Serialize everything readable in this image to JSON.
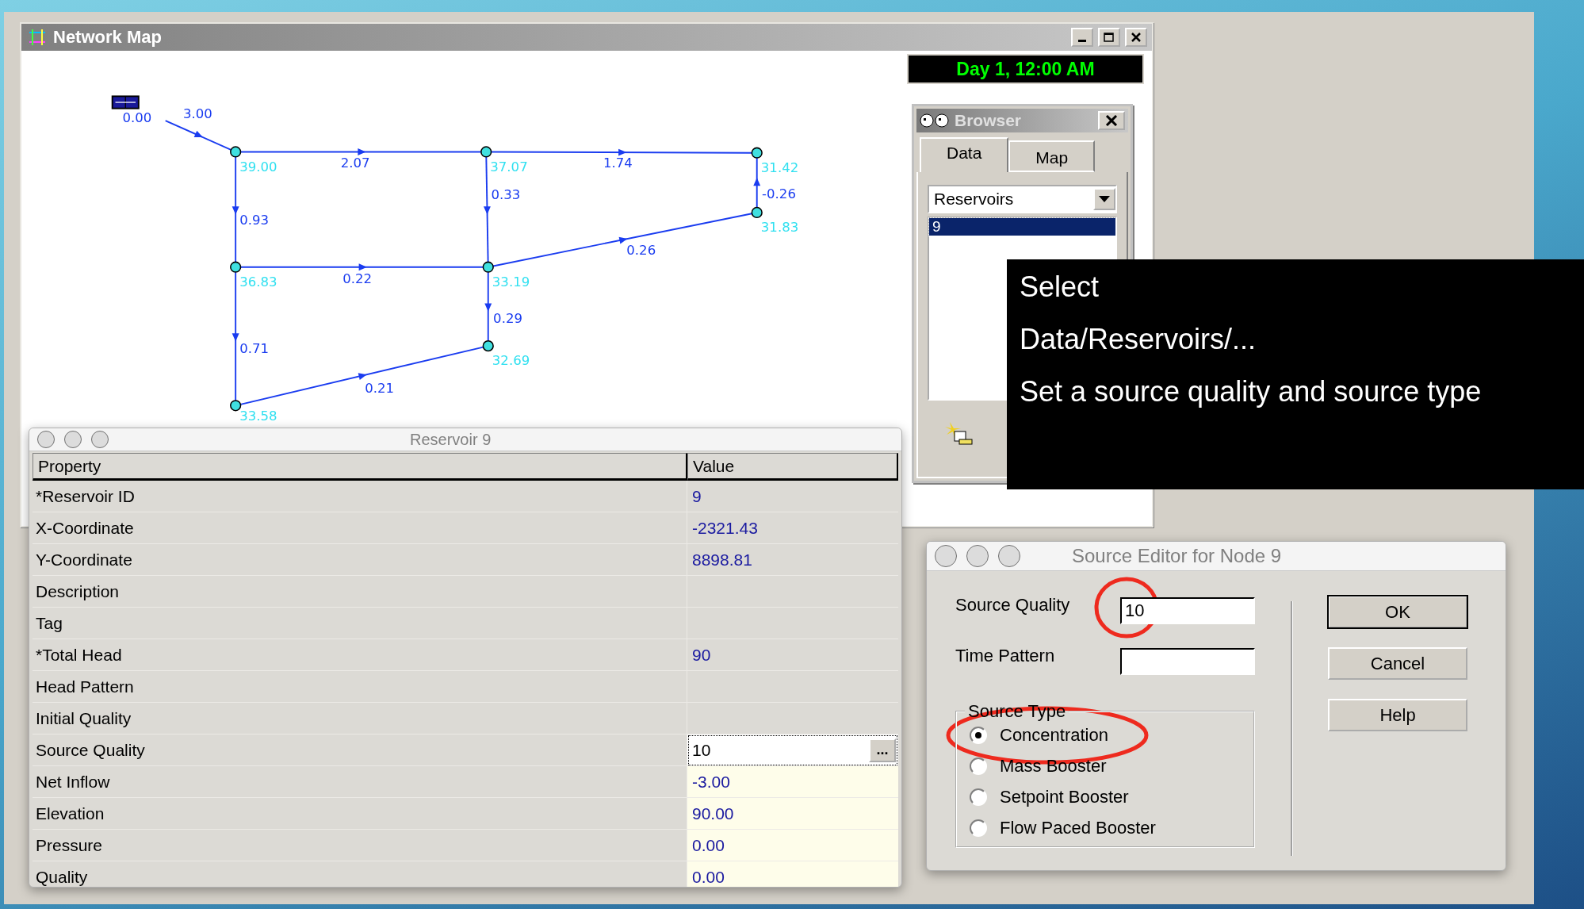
{
  "network_map": {
    "title": "Network Map",
    "reservoir": {
      "label": "0.00"
    },
    "junctions": [
      "39.00",
      "37.07",
      "31.42",
      "31.83",
      "36.83",
      "33.19",
      "32.69",
      "33.58"
    ],
    "links": [
      "3.00",
      "2.07",
      "1.74",
      "0.93",
      "0.33",
      "-0.26",
      "0.22",
      "0.26",
      "0.29",
      "0.71",
      "0.21"
    ]
  },
  "clock": "Day 1, 12:00 AM",
  "browser": {
    "title": "Browser",
    "tabs": [
      {
        "label": "Data",
        "selected": true
      },
      {
        "label": "Map",
        "selected": false
      }
    ],
    "category": "Reservoirs",
    "items": [
      {
        "label": "9",
        "selected": true
      }
    ]
  },
  "caption": [
    "Select",
    "Data/Reservoirs/...",
    "Set a source quality and source type"
  ],
  "property_editor": {
    "title": "Reservoir 9",
    "columns": [
      "Property",
      "Value"
    ],
    "rows": [
      {
        "property": "*Reservoir ID",
        "value": "9",
        "kind": "plain"
      },
      {
        "property": "X-Coordinate",
        "value": "-2321.43",
        "kind": "plain"
      },
      {
        "property": "Y-Coordinate",
        "value": "8898.81",
        "kind": "plain"
      },
      {
        "property": "Description",
        "kind": "plain"
      },
      {
        "property": "Tag",
        "kind": "plain"
      },
      {
        "property": "*Total Head",
        "value": "90",
        "kind": "plain"
      },
      {
        "property": "Head Pattern",
        "kind": "plain"
      },
      {
        "property": "Initial Quality",
        "kind": "plain"
      },
      {
        "property": "Source Quality",
        "value": "10",
        "kind": "input",
        "button": "..."
      },
      {
        "property": "Net Inflow",
        "value": "-3.00",
        "kind": "result"
      },
      {
        "property": "Elevation",
        "value": "90.00",
        "kind": "result"
      },
      {
        "property": "Pressure",
        "value": "0.00",
        "kind": "result"
      },
      {
        "property": "Quality",
        "value": "0.00",
        "kind": "result"
      }
    ]
  },
  "source_editor": {
    "title": "Source Editor for Node 9",
    "fields": [
      {
        "label": "Source Quality",
        "value": "10"
      },
      {
        "label": "Time Pattern"
      }
    ],
    "group": "Source Type",
    "options": [
      {
        "label": "Concentration",
        "selected": true
      },
      {
        "label": "Mass Booster",
        "selected": false
      },
      {
        "label": "Setpoint Booster",
        "selected": false
      },
      {
        "label": "Flow Paced Booster",
        "selected": false
      }
    ],
    "buttons": [
      {
        "label": "OK",
        "default": true
      },
      {
        "label": "Cancel",
        "default": false
      },
      {
        "label": "Help",
        "default": false
      }
    ]
  }
}
